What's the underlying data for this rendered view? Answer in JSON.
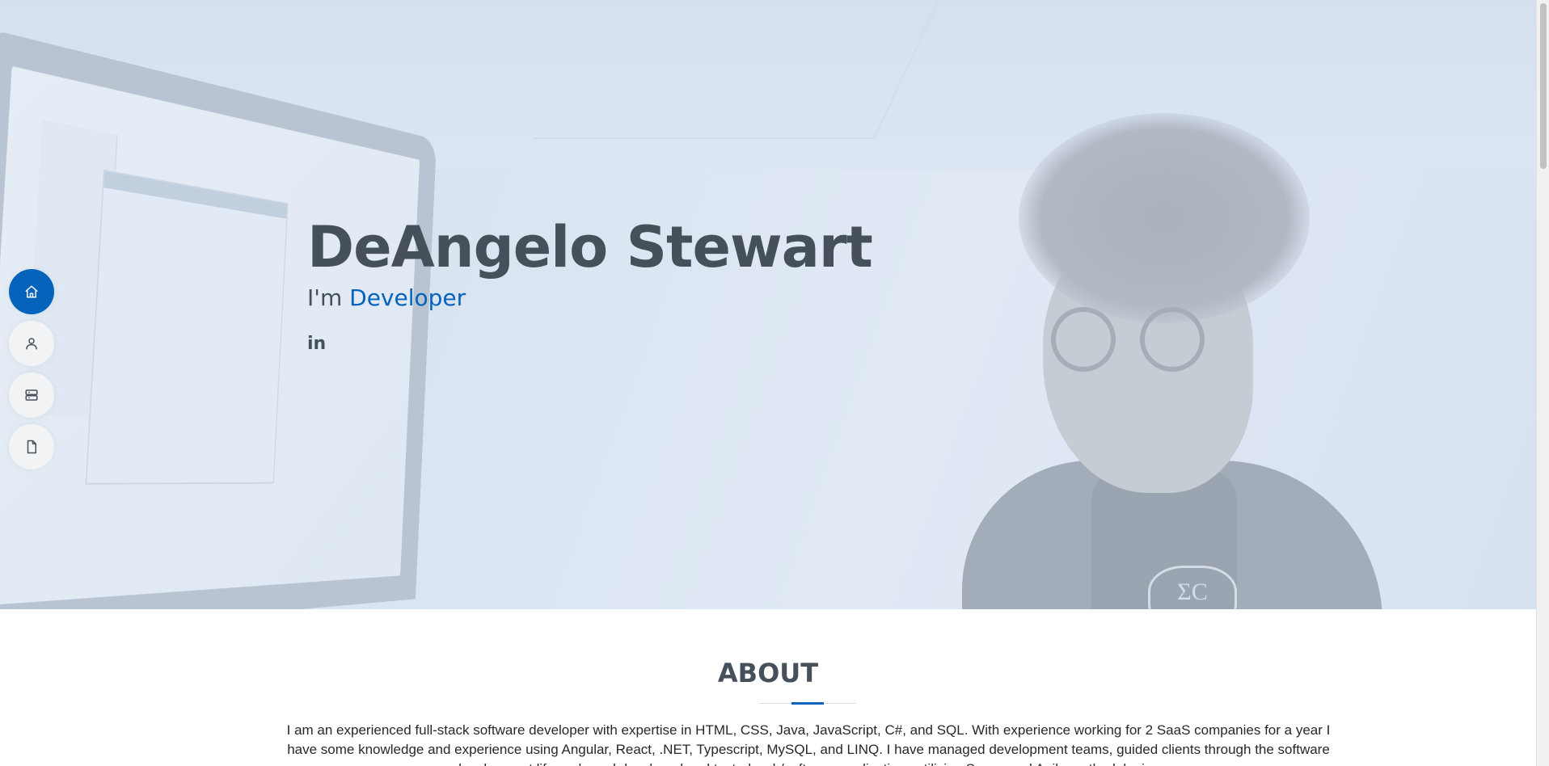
{
  "hero": {
    "name": "DeAngelo Stewart",
    "subtitle_prefix": "I'm ",
    "role": "Developer",
    "social": [
      {
        "label": "in",
        "icon": "linkedin-icon"
      }
    ]
  },
  "nav": {
    "items": [
      {
        "icon": "home-icon",
        "active": true
      },
      {
        "icon": "person-icon",
        "active": false
      },
      {
        "icon": "server-icon",
        "active": false
      },
      {
        "icon": "file-icon",
        "active": false
      }
    ]
  },
  "about": {
    "title": "ABOUT",
    "text": "I am an experienced full-stack software developer with expertise in HTML, CSS, Java, JavaScript, C#, and SQL. With experience working for 2 SaaS companies for a year I have some knowledge and experience using Angular, React, .NET, Typescript, MySQL, and LINQ. I have managed development teams, guided clients through the software development life cycle and developed and tested web/software applications utilizing Scrum and Agile methodologies."
  },
  "colors": {
    "accent": "#0563bb",
    "heading": "#45505b",
    "nav_bg": "#f2f3f5"
  }
}
